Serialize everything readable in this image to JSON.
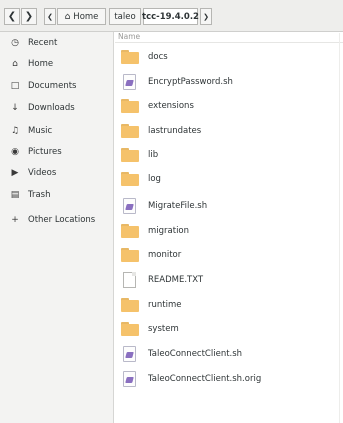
{
  "toolbar": {
    "back_icon": "chevron-left",
    "forward_icon": "chevron-right",
    "path_left_icon": "chevron-left",
    "home_label": "Home",
    "crumb_2": "taleo",
    "crumb_3": "tcc-19.4.0.2",
    "path_right_icon": "chevron-right"
  },
  "sidebar": {
    "items": [
      {
        "label": "Recent",
        "icon": "clock-icon"
      },
      {
        "label": "Home",
        "icon": "home-icon"
      },
      {
        "label": "Documents",
        "icon": "document-icon"
      },
      {
        "label": "Downloads",
        "icon": "download-icon"
      },
      {
        "label": "Music",
        "icon": "music-icon"
      },
      {
        "label": "Pictures",
        "icon": "camera-icon"
      },
      {
        "label": "Videos",
        "icon": "video-icon"
      },
      {
        "label": "Trash",
        "icon": "trash-icon"
      },
      {
        "label": "Other Locations",
        "icon": "plus-icon"
      }
    ]
  },
  "content": {
    "column_header": "Name",
    "files": [
      {
        "name": "docs",
        "type": "folder"
      },
      {
        "name": "EncryptPassword.sh",
        "type": "script"
      },
      {
        "name": "extensions",
        "type": "folder"
      },
      {
        "name": "lastrundates",
        "type": "folder"
      },
      {
        "name": "lib",
        "type": "folder"
      },
      {
        "name": "log",
        "type": "folder"
      },
      {
        "name": "MigrateFile.sh",
        "type": "script"
      },
      {
        "name": "migration",
        "type": "folder"
      },
      {
        "name": "monitor",
        "type": "folder"
      },
      {
        "name": "README.TXT",
        "type": "text"
      },
      {
        "name": "runtime",
        "type": "folder"
      },
      {
        "name": "system",
        "type": "folder"
      },
      {
        "name": "TaleoConnectClient.sh",
        "type": "script"
      },
      {
        "name": "TaleoConnectClient.sh.orig",
        "type": "script"
      }
    ]
  }
}
